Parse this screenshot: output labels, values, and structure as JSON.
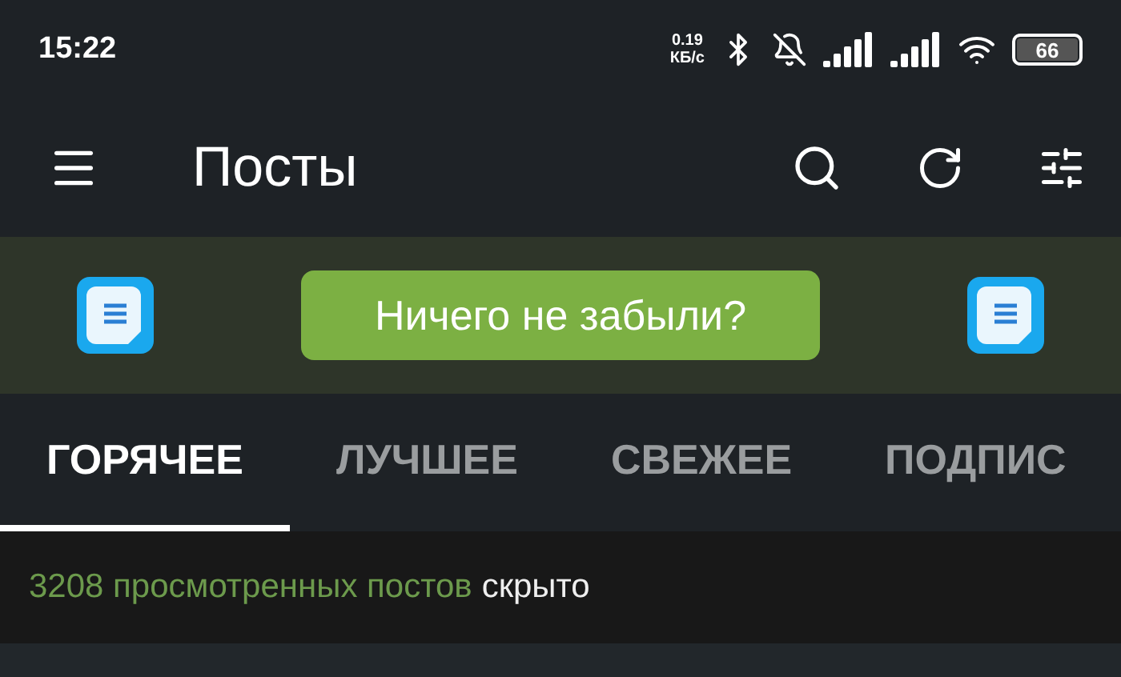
{
  "status_bar": {
    "time": "15:22",
    "net_speed": "0.19",
    "net_unit": "КБ/с",
    "battery": "66"
  },
  "app_bar": {
    "title": "Посты"
  },
  "banner": {
    "button": "Ничего не забыли?"
  },
  "tabs": [
    {
      "label": "ГОРЯЧЕЕ",
      "selected": true
    },
    {
      "label": "ЛУЧШЕЕ",
      "selected": false
    },
    {
      "label": "СВЕЖЕЕ",
      "selected": false
    },
    {
      "label": "ПОДПИС",
      "selected": false
    }
  ],
  "hidden_notice": {
    "count_text": "3208 просмотренных постов",
    "status": "скрыто"
  }
}
